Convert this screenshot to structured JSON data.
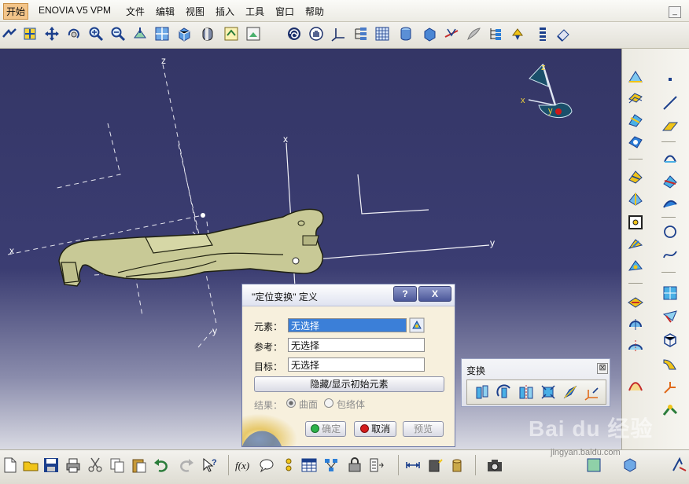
{
  "menu": {
    "items": [
      "开始",
      "ENOVIA V5 VPM",
      "文件",
      "编辑",
      "视图",
      "插入",
      "工具",
      "窗口",
      "帮助"
    ]
  },
  "viewport": {
    "axis_labels": {
      "z": "z",
      "x": "x",
      "y": "y"
    },
    "compass": {
      "z": "z",
      "x": "x",
      "y": "y"
    }
  },
  "dialog": {
    "title": "\"定位变换\" 定义",
    "help_button": "?",
    "close_button": "X",
    "element_label": "元素：",
    "element_value": "无选择",
    "reference_label": "参考：",
    "reference_value": "无选择",
    "target_label": "目标：",
    "target_value": "无选择",
    "hide_show_button": "隐藏/显示初始元素",
    "result_label": "结果：",
    "option_surface": "曲面",
    "option_envelope": "包络体",
    "ok_button": "确定",
    "cancel_button": "取消",
    "preview_button": "预览"
  },
  "transform_panel": {
    "title": "变换",
    "close": "⊠"
  },
  "watermark": {
    "logo_text": "Bai du 经验",
    "url": "jingyan.baidu.com"
  },
  "colors": {
    "viewport_bg": "#343666",
    "part_fill": "#c8c996",
    "dialog_bg": "#f7f0dd",
    "selected_field": "#3b7fd8"
  }
}
